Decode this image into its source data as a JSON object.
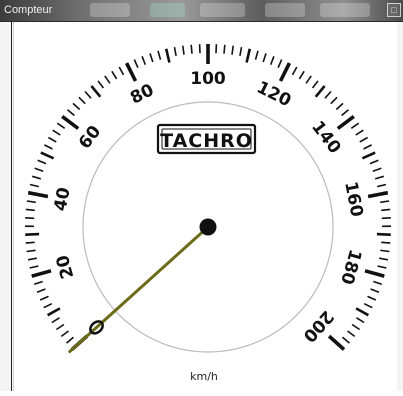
{
  "window": {
    "title": "Compteur",
    "control_icon": "maximize-icon"
  },
  "gauge": {
    "brand": "TACHRO",
    "unit": "km/h",
    "min": 0,
    "max": 200,
    "value": 0,
    "major_labels": [
      "20",
      "40",
      "60",
      "80",
      "100",
      "120",
      "140",
      "160",
      "180",
      "200"
    ],
    "colors": {
      "scale": "#111111",
      "dial_ring": "#bbbbbb",
      "needle": "#6b6b1a",
      "hub": "#111111"
    }
  }
}
